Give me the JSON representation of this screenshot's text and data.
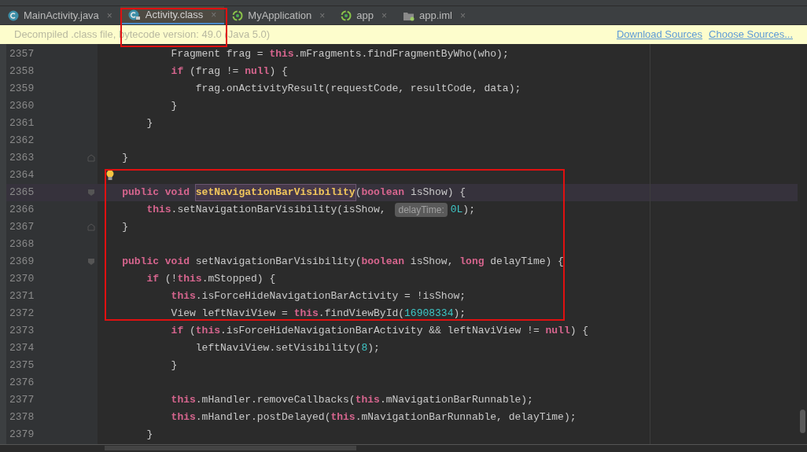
{
  "tabs": [
    {
      "label": "MainActivity.java",
      "kind": "class",
      "close": "×",
      "selected": false
    },
    {
      "label": "Activity.class",
      "kind": "locked-class",
      "close": "×",
      "selected": true
    },
    {
      "label": "MyApplication",
      "kind": "app",
      "close": "×",
      "selected": false
    },
    {
      "label": "app",
      "kind": "app",
      "close": "×",
      "selected": false
    },
    {
      "label": "app.iml",
      "kind": "folder",
      "close": "×",
      "selected": false
    }
  ],
  "notice": {
    "text": "Decompiled .class file, bytecode version: 49.0 (Java 5.0)",
    "links": [
      "Download Sources",
      "Choose Sources..."
    ]
  },
  "editor": {
    "lines": [
      {
        "number": "2357",
        "current": false,
        "bulb": false,
        "fold_start": false,
        "fold_end": false,
        "tokens": [
          {
            "kind": "plain",
            "text": "Fragment frag = "
          },
          {
            "kind": "keyword",
            "text": "this"
          },
          {
            "kind": "plain",
            "text": ".mFragments.findFragmentByWho(who);"
          }
        ]
      },
      {
        "number": "2358",
        "current": false,
        "bulb": false,
        "fold_start": false,
        "fold_end": false,
        "tokens": [
          {
            "kind": "keyword",
            "text": "if"
          },
          {
            "kind": "plain",
            "text": " (frag != "
          },
          {
            "kind": "keyword",
            "text": "null"
          },
          {
            "kind": "plain",
            "text": ") {"
          }
        ]
      },
      {
        "number": "2359",
        "current": false,
        "bulb": false,
        "fold_start": false,
        "fold_end": false,
        "tokens": [
          {
            "kind": "plain",
            "text": "frag.onActivityResult(requestCode, resultCode, data);"
          }
        ]
      },
      {
        "number": "2360",
        "current": false,
        "bulb": false,
        "fold_start": false,
        "fold_end": false,
        "tokens": [
          {
            "kind": "plain",
            "text": "}"
          }
        ]
      },
      {
        "number": "2361",
        "current": false,
        "bulb": false,
        "fold_start": false,
        "fold_end": false,
        "tokens": [
          {
            "kind": "plain",
            "text": "}"
          }
        ]
      },
      {
        "number": "2362",
        "current": false,
        "bulb": false,
        "fold_start": false,
        "fold_end": false
      },
      {
        "number": "2363",
        "current": false,
        "bulb": false,
        "fold_start": false,
        "fold_end": true,
        "tokens": [
          {
            "kind": "plain",
            "text": "}"
          }
        ]
      },
      {
        "number": "2364",
        "current": false,
        "bulb": true,
        "fold_start": false,
        "fold_end": false
      },
      {
        "number": "2365",
        "current": true,
        "bulb": false,
        "fold_start": true,
        "fold_end": false,
        "tokens": [
          {
            "kind": "keyword",
            "text": "public void "
          },
          {
            "kind": "usage",
            "text": "setNavigationBarVisibility"
          },
          {
            "kind": "plain",
            "text": "("
          },
          {
            "kind": "keyword",
            "text": "boolean"
          },
          {
            "kind": "plain",
            "text": " isShow) {"
          }
        ]
      },
      {
        "number": "2366",
        "current": false,
        "bulb": false,
        "fold_start": false,
        "fold_end": false,
        "tokens": [
          {
            "kind": "keyword",
            "text": "this"
          },
          {
            "kind": "plain",
            "text": ".setNavigationBarVisibility(isShow, "
          },
          {
            "kind": "hint",
            "text": "delayTime:"
          },
          {
            "kind": "number",
            "text": "0L"
          },
          {
            "kind": "plain",
            "text": ");"
          }
        ]
      },
      {
        "number": "2367",
        "current": false,
        "bulb": false,
        "fold_start": false,
        "fold_end": true,
        "tokens": [
          {
            "kind": "plain",
            "text": "}"
          }
        ]
      },
      {
        "number": "2368",
        "current": false,
        "bulb": false,
        "fold_start": false,
        "fold_end": false
      },
      {
        "number": "2369",
        "current": false,
        "bulb": false,
        "fold_start": true,
        "fold_end": false,
        "tokens": [
          {
            "kind": "keyword",
            "text": "public void "
          },
          {
            "kind": "plain",
            "text": "setNavigationBarVisibility("
          },
          {
            "kind": "keyword",
            "text": "boolean"
          },
          {
            "kind": "plain",
            "text": " isShow, "
          },
          {
            "kind": "keyword",
            "text": "long"
          },
          {
            "kind": "plain",
            "text": " delayTime) {"
          }
        ]
      },
      {
        "number": "2370",
        "current": false,
        "bulb": false,
        "fold_start": false,
        "fold_end": false,
        "tokens": [
          {
            "kind": "keyword",
            "text": "if"
          },
          {
            "kind": "plain",
            "text": " (!"
          },
          {
            "kind": "keyword",
            "text": "this"
          },
          {
            "kind": "plain",
            "text": ".mStopped) {"
          }
        ]
      },
      {
        "number": "2371",
        "current": false,
        "bulb": false,
        "fold_start": false,
        "fold_end": false,
        "tokens": [
          {
            "kind": "keyword",
            "text": "this"
          },
          {
            "kind": "plain",
            "text": ".isForceHideNavigationBarActivity = !isShow;"
          }
        ]
      },
      {
        "number": "2372",
        "current": false,
        "bulb": false,
        "fold_start": false,
        "fold_end": false,
        "tokens": [
          {
            "kind": "plain",
            "text": "View leftNaviView = "
          },
          {
            "kind": "keyword",
            "text": "this"
          },
          {
            "kind": "plain",
            "text": ".findViewById("
          },
          {
            "kind": "number",
            "text": "16908334"
          },
          {
            "kind": "plain",
            "text": ");"
          }
        ]
      },
      {
        "number": "2373",
        "current": false,
        "bulb": false,
        "fold_start": false,
        "fold_end": false,
        "tokens": [
          {
            "kind": "keyword",
            "text": "if"
          },
          {
            "kind": "plain",
            "text": " ("
          },
          {
            "kind": "keyword",
            "text": "this"
          },
          {
            "kind": "plain",
            "text": ".isForceHideNavigationBarActivity && leftNaviView != "
          },
          {
            "kind": "keyword",
            "text": "null"
          },
          {
            "kind": "plain",
            "text": ") {"
          }
        ]
      },
      {
        "number": "2374",
        "current": false,
        "bulb": false,
        "fold_start": false,
        "fold_end": false,
        "tokens": [
          {
            "kind": "plain",
            "text": "leftNaviView.setVisibility("
          },
          {
            "kind": "number",
            "text": "8"
          },
          {
            "kind": "plain",
            "text": ");"
          }
        ]
      },
      {
        "number": "2375",
        "current": false,
        "bulb": false,
        "fold_start": false,
        "fold_end": false,
        "tokens": [
          {
            "kind": "plain",
            "text": "}"
          }
        ]
      },
      {
        "number": "2376",
        "current": false,
        "bulb": false,
        "fold_start": false,
        "fold_end": false
      },
      {
        "number": "2377",
        "current": false,
        "bulb": false,
        "fold_start": false,
        "fold_end": false,
        "tokens": [
          {
            "kind": "keyword",
            "text": "this"
          },
          {
            "kind": "plain",
            "text": ".mHandler.removeCallbacks("
          },
          {
            "kind": "keyword",
            "text": "this"
          },
          {
            "kind": "plain",
            "text": ".mNavigationBarRunnable);"
          }
        ]
      },
      {
        "number": "2378",
        "current": false,
        "bulb": false,
        "fold_start": false,
        "fold_end": false,
        "tokens": [
          {
            "kind": "keyword",
            "text": "this"
          },
          {
            "kind": "plain",
            "text": ".mHandler.postDelayed("
          },
          {
            "kind": "keyword",
            "text": "this"
          },
          {
            "kind": "plain",
            "text": ".mNavigationBarRunnable, delayTime);"
          }
        ]
      },
      {
        "number": "2379",
        "current": false,
        "bulb": false,
        "fold_start": false,
        "fold_end": false,
        "tokens": [
          {
            "kind": "plain",
            "text": "}"
          }
        ]
      }
    ]
  }
}
